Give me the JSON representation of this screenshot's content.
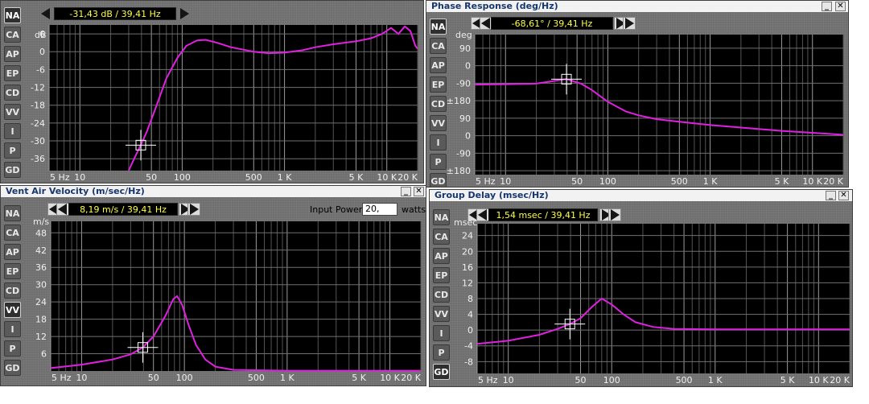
{
  "tabs": [
    "NA",
    "CA",
    "AP",
    "EP",
    "CD",
    "VV",
    "I",
    "P",
    "GD"
  ],
  "input_power": {
    "label": "Input Power:",
    "value": "20,",
    "unit": "watts"
  },
  "chart_data": [
    {
      "id": "spl",
      "type": "line",
      "title": "",
      "readout": "-31,43 dB / 39,41 Hz",
      "unit_label": "dB",
      "active_tab": "NA",
      "xlabel": "",
      "ylabel": "dB",
      "xscale": "log",
      "x_ticks": [
        5,
        10,
        50,
        100,
        500,
        1000,
        5000,
        10000,
        20000
      ],
      "x_tick_labels": [
        "5 Hz",
        "10",
        "50",
        "100",
        "500",
        "1 K",
        "5 K",
        "10 K",
        "20 K"
      ],
      "y_ticks": [
        6,
        0,
        -6,
        -12,
        -18,
        -24,
        -30,
        -36
      ],
      "y_tick_labels": [
        "6",
        "0",
        "-6",
        "-12",
        "-18",
        "-24",
        "-30",
        "-36"
      ],
      "ylim": [
        -40,
        9
      ],
      "series": [
        {
          "color": "#e020e0",
          "points": [
            [
              30,
              -40
            ],
            [
              35,
              -35
            ],
            [
              39.41,
              -31.43
            ],
            [
              45,
              -27
            ],
            [
              55,
              -19
            ],
            [
              70,
              -9
            ],
            [
              90,
              -2
            ],
            [
              110,
              2
            ],
            [
              140,
              3.8
            ],
            [
              170,
              4
            ],
            [
              220,
              3
            ],
            [
              300,
              1.5
            ],
            [
              500,
              0
            ],
            [
              700,
              -0.5
            ],
            [
              1000,
              -0.3
            ],
            [
              1500,
              0.5
            ],
            [
              2000,
              1.5
            ],
            [
              3000,
              2.5
            ],
            [
              5000,
              3.5
            ],
            [
              7000,
              4.5
            ],
            [
              9000,
              6
            ],
            [
              11000,
              8
            ],
            [
              13000,
              6
            ],
            [
              15000,
              8.5
            ],
            [
              17000,
              7
            ],
            [
              19000,
              2
            ],
            [
              20000,
              1
            ]
          ]
        }
      ],
      "cursor": {
        "x": 39.41,
        "y": -31.43
      }
    },
    {
      "id": "phase",
      "type": "line",
      "title": "Phase Response (deg/Hz)",
      "readout": "-68,61° / 39,41 Hz",
      "unit_label": "deg",
      "active_tab": "NA",
      "xlabel": "",
      "ylabel": "deg",
      "xscale": "log",
      "x_ticks": [
        5,
        10,
        50,
        100,
        500,
        1000,
        5000,
        10000,
        20000
      ],
      "x_tick_labels": [
        "5 Hz",
        "10",
        "50",
        "100",
        "500",
        "1 K",
        "5 K",
        "10 K",
        "20 K"
      ],
      "y_ticks": [
        450,
        360,
        270,
        180,
        90,
        0,
        -90,
        -180
      ],
      "y_tick_labels": [
        "90",
        "0",
        "-90",
        "±180",
        "90",
        "0",
        "-90",
        "±180"
      ],
      "ylim": [
        -200,
        520
      ],
      "series": [
        {
          "color": "#e020e0",
          "points": [
            [
              5,
              263
            ],
            [
              10,
              265
            ],
            [
              20,
              268
            ],
            [
              39.41,
              291
            ],
            [
              55,
              267
            ],
            [
              70,
              235
            ],
            [
              100,
              175
            ],
            [
              150,
              125
            ],
            [
              200,
              105
            ],
            [
              300,
              85
            ],
            [
              500,
              72
            ],
            [
              1000,
              55
            ],
            [
              2000,
              42
            ],
            [
              5000,
              25
            ],
            [
              10000,
              15
            ],
            [
              20000,
              5
            ]
          ]
        }
      ],
      "cursor": {
        "x": 39.41,
        "y": 291
      }
    },
    {
      "id": "vent",
      "type": "line",
      "title": "Vent Air Velocity (m/sec/Hz)",
      "readout": "8,19 m/s / 39,41 Hz",
      "unit_label": "m/s",
      "active_tab": "VV",
      "xlabel": "",
      "ylabel": "m/s",
      "xscale": "log",
      "x_ticks": [
        5,
        10,
        50,
        100,
        500,
        1000,
        5000,
        10000,
        20000
      ],
      "x_tick_labels": [
        "5 Hz",
        "10",
        "50",
        "100",
        "500",
        "1 K",
        "5 K",
        "10 K",
        "20 K"
      ],
      "y_ticks": [
        48,
        42,
        36,
        30,
        24,
        18,
        12,
        6
      ],
      "y_tick_labels": [
        "48",
        "42",
        "36",
        "30",
        "24",
        "18",
        "12",
        "6"
      ],
      "ylim": [
        0,
        52
      ],
      "series": [
        {
          "color": "#e020e0",
          "points": [
            [
              5,
              1
            ],
            [
              10,
              2.2
            ],
            [
              20,
              4
            ],
            [
              30,
              5.8
            ],
            [
              39.41,
              8.19
            ],
            [
              50,
              12
            ],
            [
              65,
              19
            ],
            [
              78,
              25
            ],
            [
              85,
              26
            ],
            [
              95,
              23
            ],
            [
              110,
              16
            ],
            [
              130,
              9
            ],
            [
              160,
              4
            ],
            [
              200,
              1.5
            ],
            [
              300,
              0.4
            ],
            [
              1000,
              0.1
            ],
            [
              20000,
              0.1
            ]
          ]
        }
      ],
      "cursor": {
        "x": 39.41,
        "y": 8.19
      }
    },
    {
      "id": "gd",
      "type": "line",
      "title": "Group Delay (msec/Hz)",
      "readout": "1,54 msec / 39,41 Hz",
      "unit_label": "msec",
      "active_tab": "GD",
      "xlabel": "",
      "ylabel": "msec",
      "xscale": "log",
      "x_ticks": [
        5,
        10,
        50,
        100,
        500,
        1000,
        5000,
        10000,
        20000
      ],
      "x_tick_labels": [
        "5 Hz",
        "10",
        "50",
        "100",
        "500",
        "1 K",
        "5 K",
        "10 K",
        "20 K"
      ],
      "y_ticks": [
        24,
        20,
        16,
        12,
        8,
        4,
        0,
        -4,
        -8
      ],
      "y_tick_labels": [
        "24",
        "20",
        "16",
        "12",
        "8",
        "4",
        "0",
        "-4",
        "-8"
      ],
      "ylim": [
        -11,
        27
      ],
      "series": [
        {
          "color": "#e020e0",
          "points": [
            [
              5,
              -3.5
            ],
            [
              10,
              -2.7
            ],
            [
              20,
              -1.2
            ],
            [
              30,
              0.3
            ],
            [
              39.41,
              1.54
            ],
            [
              50,
              3
            ],
            [
              65,
              6
            ],
            [
              80,
              8
            ],
            [
              100,
              6.5
            ],
            [
              130,
              4
            ],
            [
              170,
              2
            ],
            [
              250,
              0.8
            ],
            [
              400,
              0.3
            ],
            [
              1000,
              0.2
            ],
            [
              20000,
              0.2
            ]
          ]
        }
      ],
      "cursor": {
        "x": 39.41,
        "y": 1.54
      }
    }
  ]
}
